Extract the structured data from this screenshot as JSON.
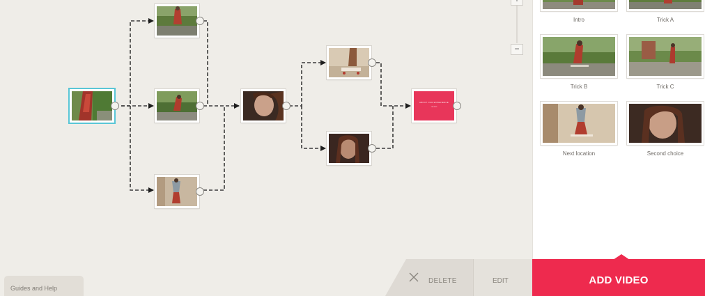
{
  "canvas": {
    "zoom_in_symbol": "+",
    "zoom_out_symbol": "−"
  },
  "end_card": {
    "line1": "ABOUT OUR EXPERIENCE",
    "line2": "THE END"
  },
  "library": {
    "items": [
      {
        "caption": "Intro"
      },
      {
        "caption": "Trick A"
      },
      {
        "caption": "Trick B"
      },
      {
        "caption": "Trick C"
      },
      {
        "caption": "Next location"
      },
      {
        "caption": "Second choice"
      }
    ]
  },
  "footer": {
    "guides_label": "Guides and Help",
    "delete_label": "DELETE",
    "edit_label": "EDIT",
    "add_video_label": "ADD VIDEO"
  },
  "colors": {
    "accent": "#ee2a4e",
    "canvas_bg": "#efede8",
    "selected_outline": "#59c6d6"
  }
}
